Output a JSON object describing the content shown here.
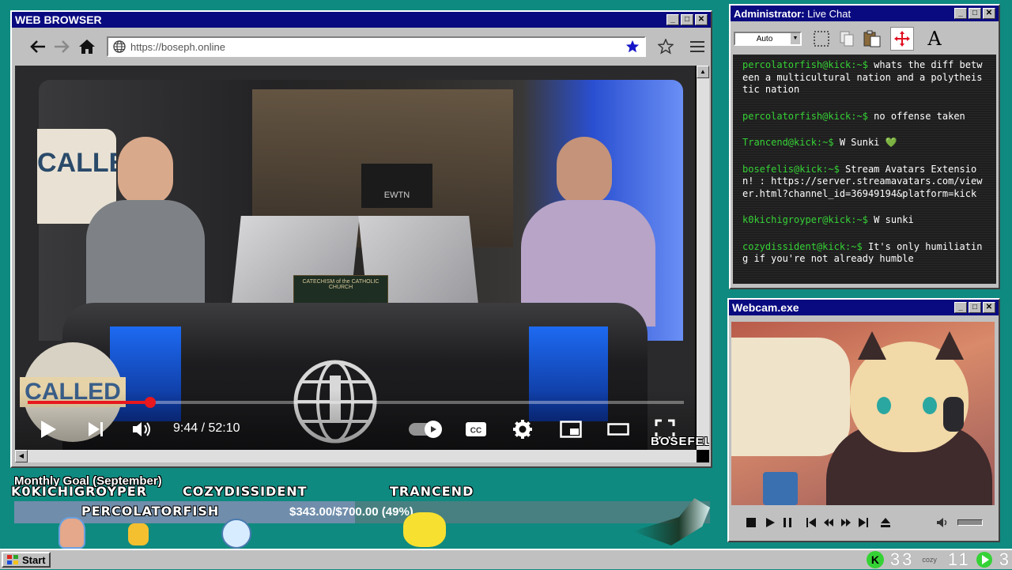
{
  "browser": {
    "title": "WEB BROWSER",
    "url": "https://boseph.online",
    "video": {
      "time_current": "9:44",
      "time_separator": " / ",
      "time_total": "52:10",
      "progress": 0.187,
      "studio_sign": "CALLED",
      "logo_text": "CALLED",
      "network": "EWTN",
      "book_title": "CATECHISM of the CATHOLIC CHURCH"
    },
    "watermark": "BOSEFELIS"
  },
  "chat": {
    "title_prefix": "Administrator:",
    "title": " Live Chat",
    "dropdown_value": "Auto",
    "messages": [
      {
        "user": "percolatorfish@kick:~$",
        "text": " whats the diff between a multicultural nation and a polytheistic nation"
      },
      {
        "user": "percolatorfish@kick:~$",
        "text": " no offense taken"
      },
      {
        "user": "Trancend@kick:~$",
        "text": " W Sunki 💚"
      },
      {
        "user": "bosefelis@kick:~$",
        "text": " Stream Avatars Extension! : https://server.streamavatars.com/viewer.html?channel_id=36949194&platform=kick"
      },
      {
        "user": "k0kichigroyper@kick:~$",
        "text": " W sunki"
      },
      {
        "user": "cozydissident@kick:~$",
        "text": " It's only humiliating if you're not already humble"
      }
    ]
  },
  "webcam": {
    "title": "Webcam.exe"
  },
  "goal": {
    "label": "Monthly Goal (September)",
    "amount": "$343.00/$700.00 (49%)",
    "fraction": 0.49,
    "avatars": [
      "K0KICHIGROYPER",
      "PERCOLATORFISH",
      "COZYDISSIDENT",
      "TRANCEND"
    ]
  },
  "taskbar": {
    "start_label": "Start",
    "kick_count": "33",
    "cozy_label": "cozy",
    "cozy_count": "11",
    "play_count": "3"
  },
  "colors": {
    "desktop": "#0f8a80",
    "titlebar": "#0a0a80",
    "chat_user": "#35d235",
    "progress": "#e8181e"
  }
}
